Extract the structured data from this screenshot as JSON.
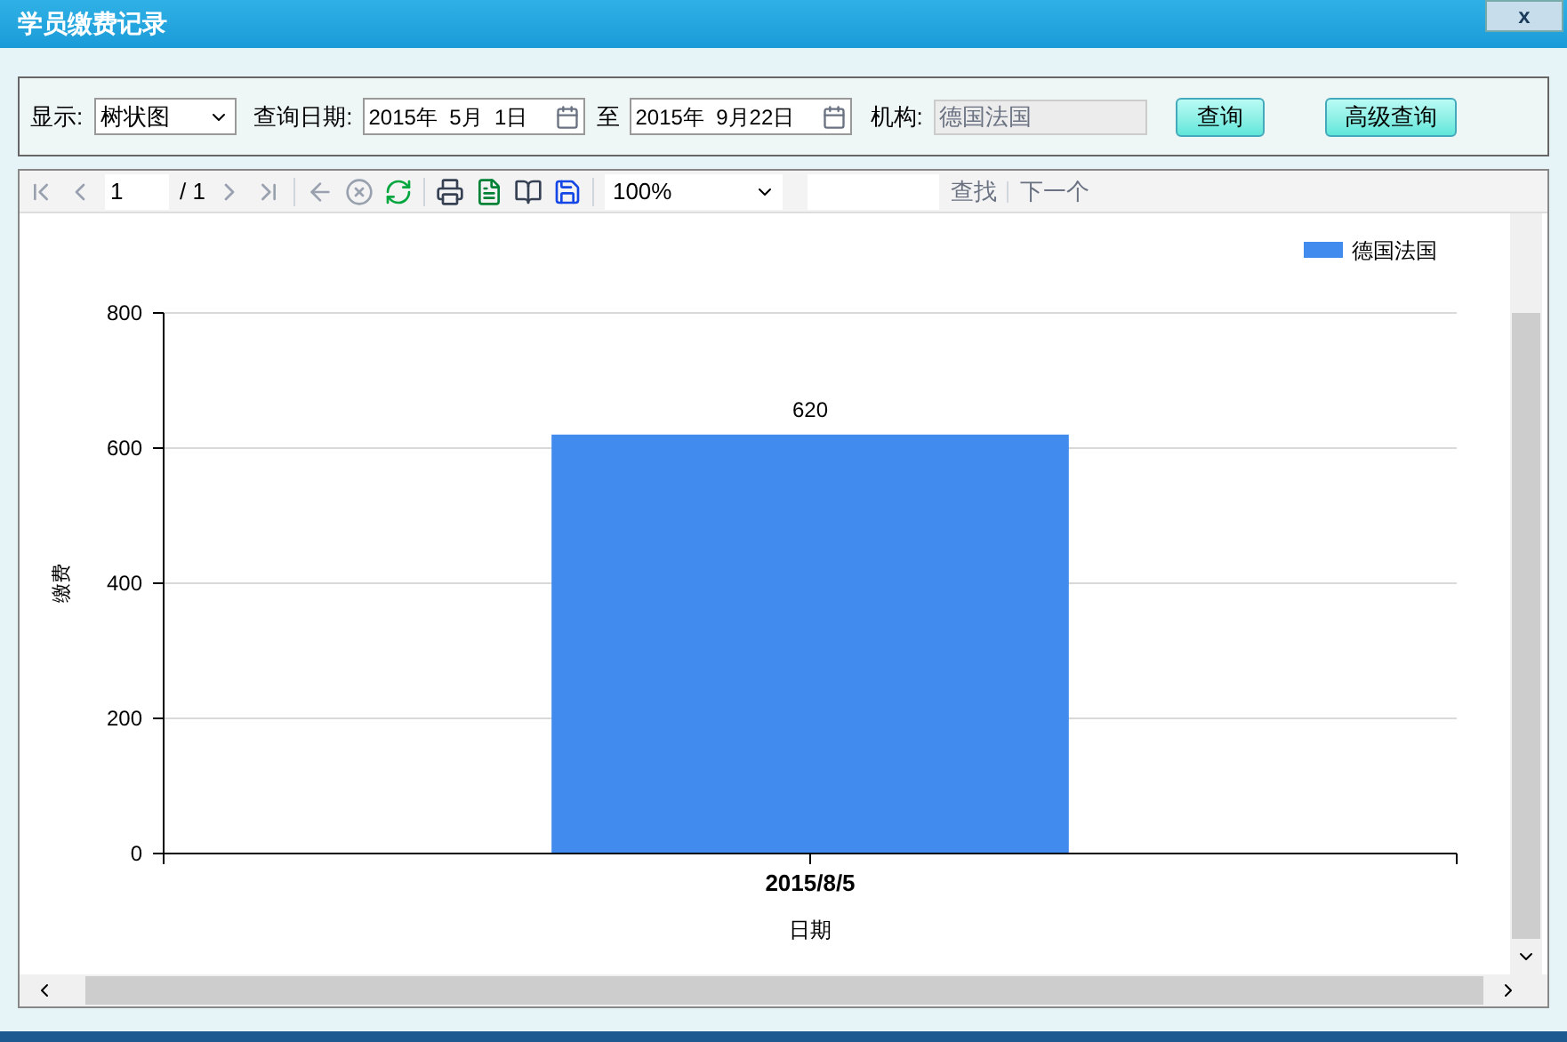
{
  "window": {
    "title": "学员缴费记录",
    "close": "x"
  },
  "filters": {
    "display_label": "显示:",
    "display_value": "树状图",
    "date_label": "查询日期:",
    "date_from": "2015年  5月  1日",
    "to_label": "至",
    "date_to": "2015年  9月22日",
    "org_label": "机构:",
    "org_value": "德国法国",
    "query_button": "查询",
    "advanced_button": "高级查询"
  },
  "toolbar": {
    "page": "1",
    "page_total": "/ 1",
    "zoom": "100%",
    "find": "查找",
    "next": "下一个"
  },
  "chart_data": {
    "type": "bar",
    "xlabel": "日期",
    "ylabel": "缴费",
    "categories": [
      "2015/8/5"
    ],
    "series": [
      {
        "name": "德国法国",
        "color": "#418bee",
        "values": [
          620
        ]
      }
    ],
    "ylim": [
      0,
      800
    ],
    "yticks": [
      0,
      200,
      400,
      600,
      800
    ],
    "data_labels": true,
    "grid": true
  }
}
